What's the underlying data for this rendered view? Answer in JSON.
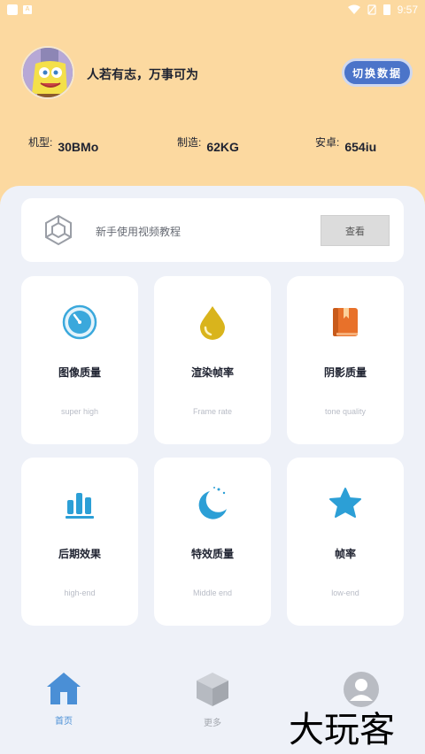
{
  "status_bar": {
    "time": "9:57"
  },
  "header": {
    "motto": "人若有志，万事可为",
    "switch_button": "切换数据",
    "specs": [
      {
        "label": "机型:",
        "value": "30BMo"
      },
      {
        "label": "制造:",
        "value": "62KG"
      },
      {
        "label": "安卓:",
        "value": "654iu"
      }
    ]
  },
  "tutorial": {
    "text": "新手使用视频教程",
    "button": "查看"
  },
  "cards": [
    {
      "title": "图像质量",
      "subtitle": "super high",
      "icon": "stopwatch-icon",
      "color": "#3aa8dc"
    },
    {
      "title": "渲染帧率",
      "subtitle": "Frame rate",
      "icon": "droplet-icon",
      "color": "#d9b41c"
    },
    {
      "title": "阴影质量",
      "subtitle": "tone quality",
      "icon": "book-icon",
      "color": "#e8712a"
    },
    {
      "title": "后期效果",
      "subtitle": "high-end",
      "icon": "bar-chart-icon",
      "color": "#2c9fd6"
    },
    {
      "title": "特效质量",
      "subtitle": "Middle end",
      "icon": "moon-icon",
      "color": "#2c9fd6"
    },
    {
      "title": "帧率",
      "subtitle": "low-end",
      "icon": "star-icon",
      "color": "#2c9fd6"
    }
  ],
  "bottom_nav": [
    {
      "label": "首页",
      "icon": "home-icon",
      "active": true
    },
    {
      "label": "更多",
      "icon": "cube-icon",
      "active": false
    },
    {
      "label": "",
      "icon": "user-icon",
      "active": false
    }
  ],
  "watermark": "大玩客",
  "colors": {
    "header_bg": "#fcd9a0",
    "accent": "#4b74c9",
    "page_bg": "#eef1f8"
  }
}
